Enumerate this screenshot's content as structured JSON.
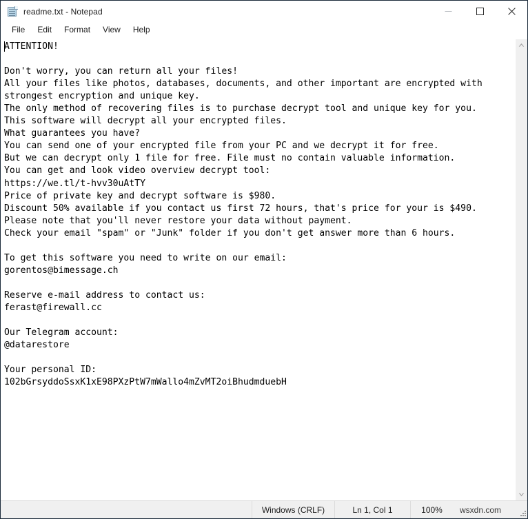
{
  "window": {
    "title": "readme.txt - Notepad",
    "icon": "notepad-icon",
    "border_color": "#1b2a3a",
    "caption": {
      "minimize": "—",
      "maximize": "□",
      "close": "✕"
    }
  },
  "menu": {
    "items": [
      {
        "label": "File"
      },
      {
        "label": "Edit"
      },
      {
        "label": "Format"
      },
      {
        "label": "View"
      },
      {
        "label": "Help"
      }
    ]
  },
  "document": {
    "filename": "readme.txt",
    "content": "ATTENTION!\n\nDon't worry, you can return all your files!\nAll your files like photos, databases, documents, and other important are encrypted with\nstrongest encryption and unique key.\nThe only method of recovering files is to purchase decrypt tool and unique key for you.\nThis software will decrypt all your encrypted files.\nWhat guarantees you have?\nYou can send one of your encrypted file from your PC and we decrypt it for free.\nBut we can decrypt only 1 file for free. File must no contain valuable information.\nYou can get and look video overview decrypt tool:\nhttps://we.tl/t-hvv30uAtTY\nPrice of private key and decrypt software is $980.\nDiscount 50% available if you contact us first 72 hours, that's price for your is $490.\nPlease note that you'll never restore your data without payment.\nCheck your email \"spam\" or \"Junk\" folder if you don't get answer more than 6 hours.\n\nTo get this software you need to write on our email:\ngorentos@bimessage.ch\n\nReserve e-mail address to contact us:\nferast@firewall.cc\n\nOur Telegram account:\n@datarestore\n\nYour personal ID:\n102bGrsyddoSsxK1xE98PXzPtW7mWallo4mZvMT2oiBhudmduebH",
    "lines": [
      "ATTENTION!",
      "",
      "Don't worry, you can return all your files!",
      "All your files like photos, databases, documents, and other important are encrypted with",
      "strongest encryption and unique key.",
      "The only method of recovering files is to purchase decrypt tool and unique key for you.",
      "This software will decrypt all your encrypted files.",
      "What guarantees you have?",
      "You can send one of your encrypted file from your PC and we decrypt it for free.",
      "But we can decrypt only 1 file for free. File must no contain valuable information.",
      "You can get and look video overview decrypt tool:",
      "https://we.tl/t-hvv30uAtTY",
      "Price of private key and decrypt software is $980.",
      "Discount 50% available if you contact us first 72 hours, that's price for your is $490.",
      "Please note that you'll never restore your data without payment.",
      "Check your email \"spam\" or \"Junk\" folder if you don't get answer more than 6 hours.",
      "",
      "To get this software you need to write on our email:",
      "gorentos@bimessage.ch",
      "",
      "Reserve e-mail address to contact us:",
      "ferast@firewall.cc",
      "",
      "Our Telegram account:",
      "@datarestore",
      "",
      "Your personal ID:",
      "102bGrsyddoSsxK1xE98PXzPtW7mWallo4mZvMT2oiBhudmduebH"
    ],
    "ransom_details": {
      "video_url": "https://we.tl/t-hvv30uAtTY",
      "price": "$980",
      "discount_price": "$490",
      "discount_percent": "50%",
      "discount_window": "72 hours",
      "response_time": "6 hours",
      "free_decrypt_files": "1 file",
      "primary_email": "gorentos@bimessage.ch",
      "reserve_email": "ferast@firewall.cc",
      "telegram": "@datarestore",
      "personal_id": "102bGrsyddoSsxK1xE98PXzPtW7mWallo4mZvMT2oiBhudmduebH"
    }
  },
  "scrollbar": {
    "up_arrow": "▲",
    "down_arrow": "▼"
  },
  "statusbar": {
    "line_ending": "Windows (CRLF)",
    "position": "Ln 1, Col 1",
    "zoom": "100%",
    "watermark": "wsxdn.com"
  }
}
